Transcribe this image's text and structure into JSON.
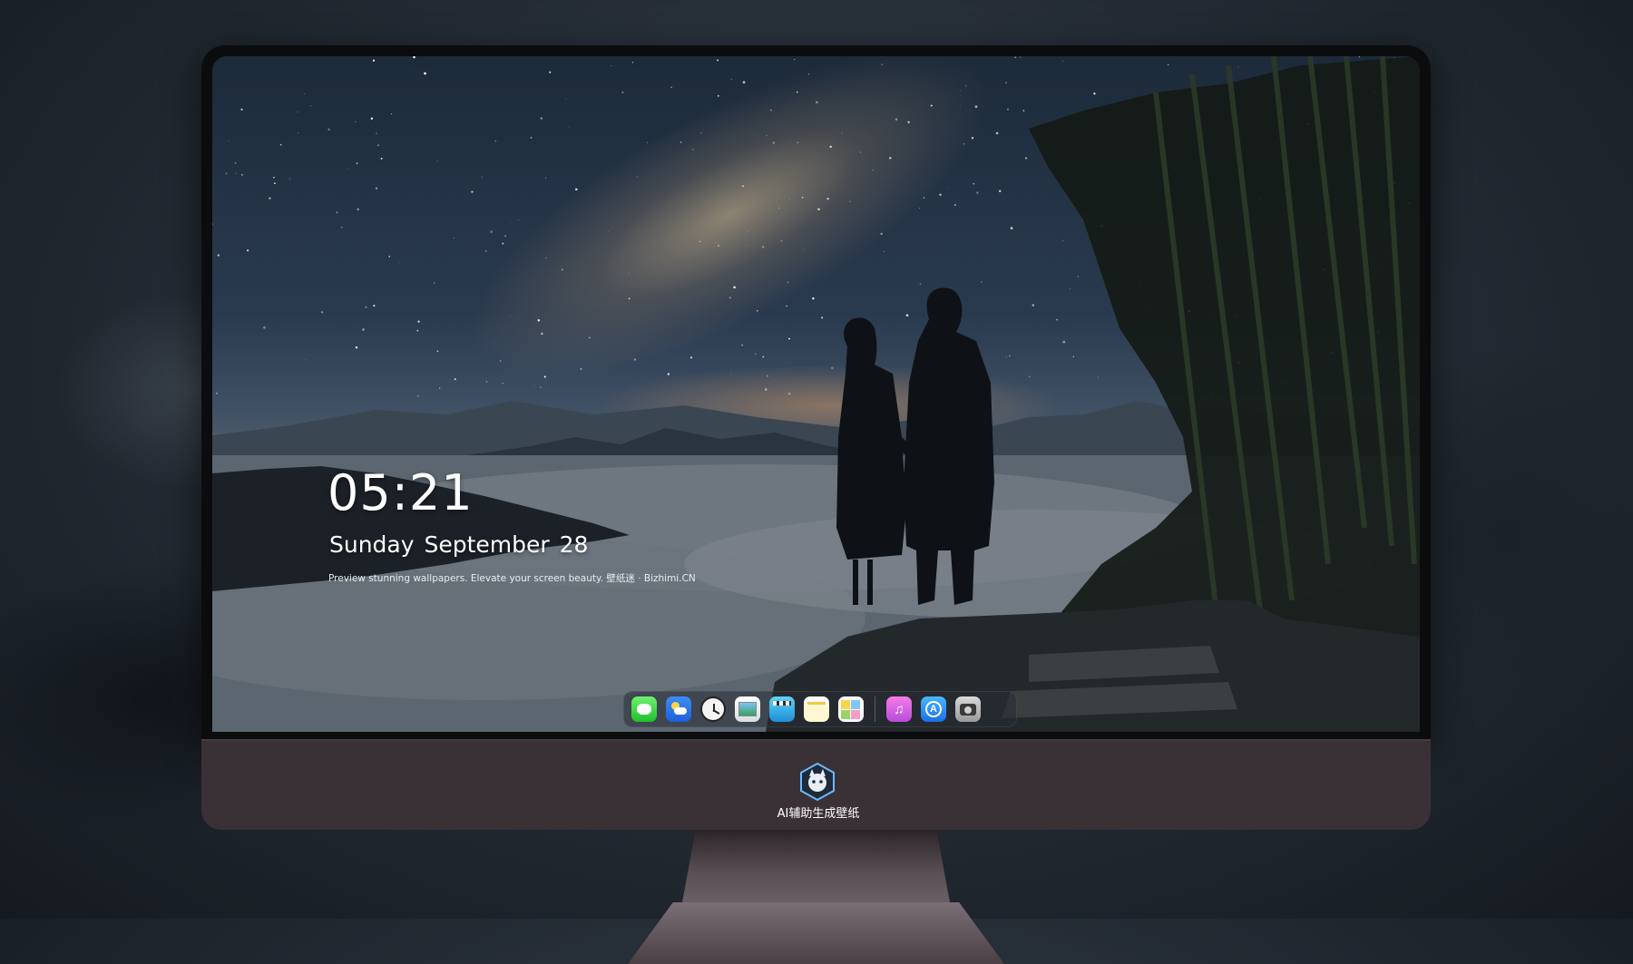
{
  "lockscreen": {
    "time": "05:21",
    "date": "Sunday September  28",
    "tagline": "Preview stunning wallpapers. Elevate your screen beauty. 壁纸迷 · Bizhimi.CN"
  },
  "dock": {
    "apps": [
      {
        "name": "Messages",
        "icon": "messages-icon"
      },
      {
        "name": "Weather",
        "icon": "weather-icon"
      },
      {
        "name": "Clock",
        "icon": "clock-icon"
      },
      {
        "name": "Preview",
        "icon": "preview-icon"
      },
      {
        "name": "Clips",
        "icon": "clips-icon"
      },
      {
        "name": "Notes",
        "icon": "notes-icon"
      },
      {
        "name": "Stickies",
        "icon": "stickies-icon"
      },
      {
        "name": "Music",
        "icon": "music-icon"
      },
      {
        "name": "App Store",
        "icon": "app-store-icon"
      },
      {
        "name": "Camera",
        "icon": "camera-icon"
      }
    ]
  },
  "monitor": {
    "brand_label": "AI辅助生成壁纸",
    "logo_icon": "cat-mascot-logo"
  },
  "colors": {
    "chin": "#3a3136",
    "bezel": "#0b0c0e",
    "night_sky": "#1c2a3a",
    "dock_bg": "rgba(40,44,52,0.55)"
  }
}
